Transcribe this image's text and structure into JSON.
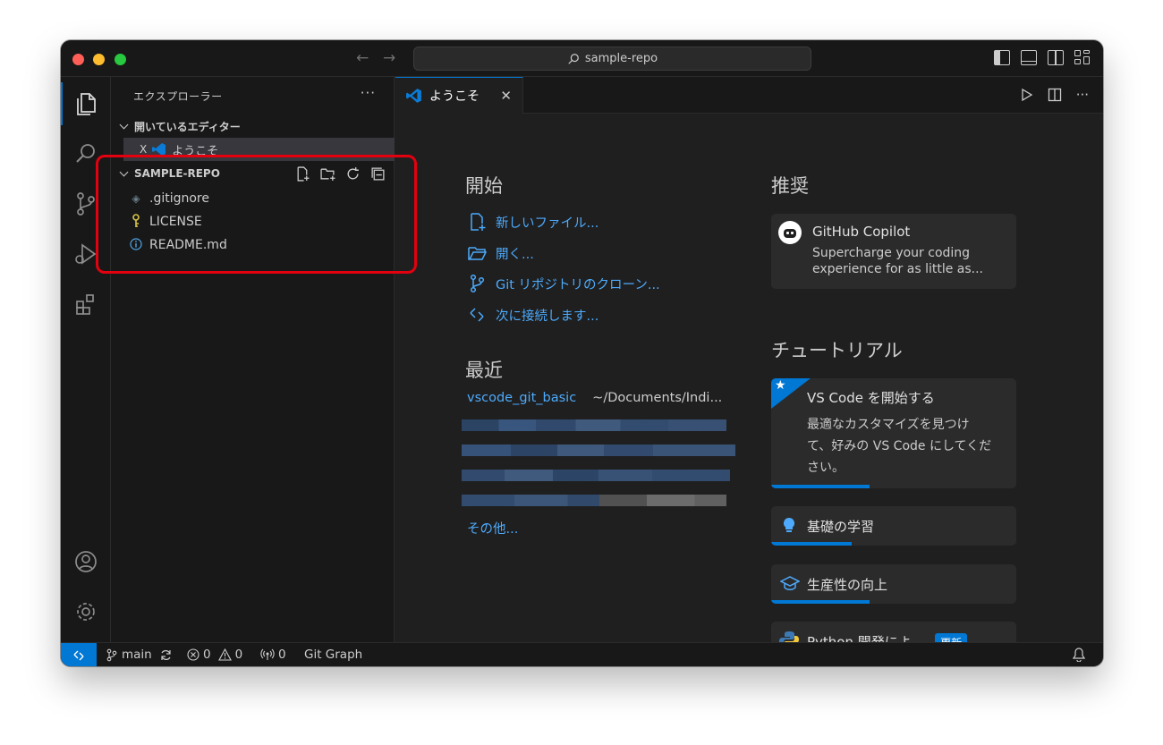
{
  "titlebar": {
    "search_text": "sample-repo"
  },
  "sidebar": {
    "title": "エクスプローラー",
    "more": "···",
    "open_editors": {
      "label": "開いているエディター",
      "items": [
        {
          "close": "X",
          "label": "ようこそ"
        }
      ]
    },
    "folder": {
      "label": "SAMPLE-REPO",
      "files": [
        {
          "name": ".gitignore",
          "icon": "diamond-icon"
        },
        {
          "name": "LICENSE",
          "icon": "key-icon"
        },
        {
          "name": "README.md",
          "icon": "info-icon"
        }
      ]
    }
  },
  "editor": {
    "tab": {
      "label": "ようこそ",
      "close": "✕"
    },
    "start": {
      "heading": "開始",
      "links": [
        "新しいファイル...",
        "開く...",
        "Git リポジトリのクローン...",
        "次に接続します..."
      ]
    },
    "recent": {
      "heading": "最近",
      "item_name": "vscode_git_basic",
      "item_path": "~/Documents/Indi...",
      "more": "その他..."
    },
    "recommended": {
      "heading": "推奨",
      "card_title": "GitHub Copilot",
      "card_desc_1": "Supercharge your coding",
      "card_desc_2": "experience for as little as..."
    },
    "tutorials": {
      "heading": "チュートリアル",
      "vscode_title": "VS Code を開始する",
      "vscode_desc_1": "最適なカスタマイズを見つけ",
      "vscode_desc_2": "て、好みの VS Code にしてくだ",
      "vscode_desc_3": "さい。",
      "vscode_progress": 0.4,
      "fundamentals": "基礎の学習",
      "fundamentals_progress": 0.33,
      "productivity": "生産性の向上",
      "productivity_progress": 0.4,
      "python": "Python 開発によ...",
      "python_badge": "更新",
      "python_progress": 0.25
    }
  },
  "statusbar": {
    "remote": "><",
    "branch": "main",
    "errors": "0",
    "warnings": "0",
    "ports": "0",
    "git_graph": "Git Graph"
  },
  "colors": {
    "accent": "#0078d4",
    "link": "#4daafc",
    "highlight_box": "#e3000f"
  }
}
